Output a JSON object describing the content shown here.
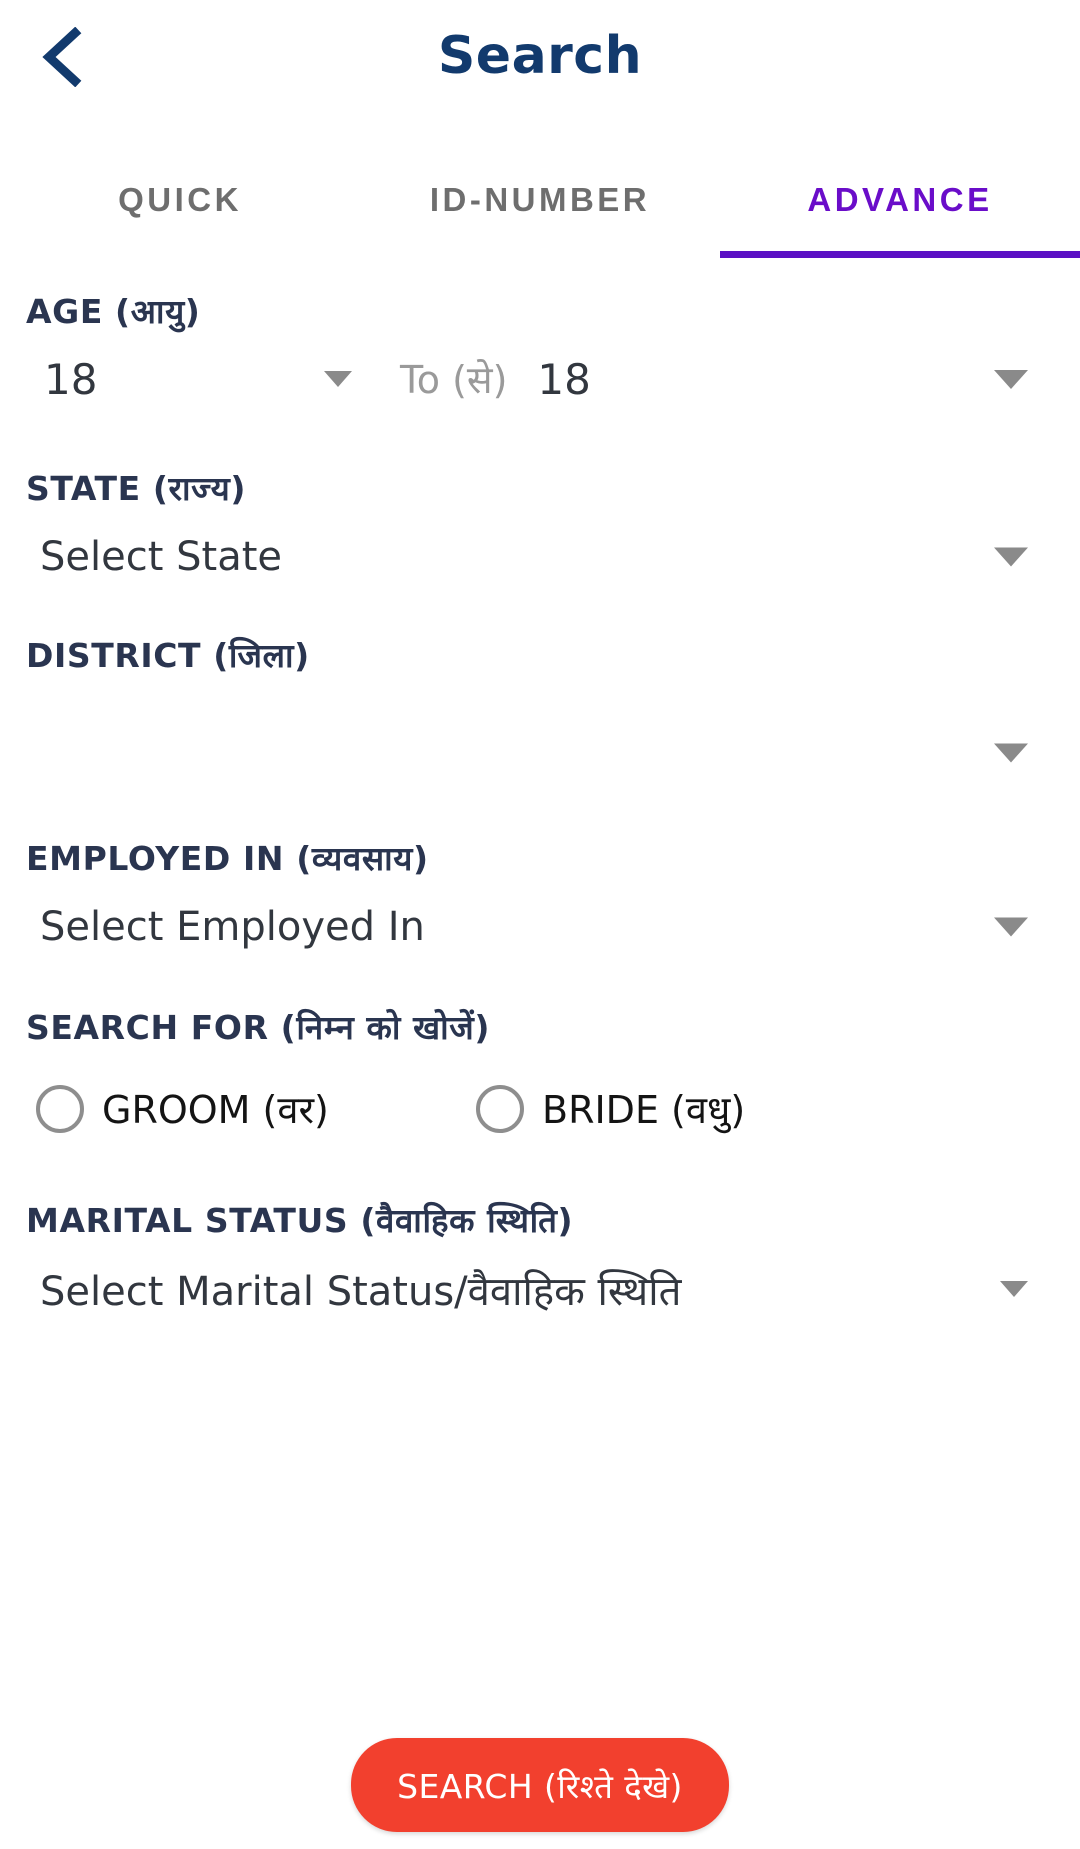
{
  "header": {
    "title": "Search",
    "back_icon": "chevron-left-icon",
    "title_color": "#123A6D"
  },
  "tabs": {
    "items": [
      {
        "label": "QUICK",
        "active": false
      },
      {
        "label": "ID-NUMBER",
        "active": false
      },
      {
        "label": "ADVANCE",
        "active": true
      }
    ],
    "active_color": "#6A0DC9",
    "inactive_color": "#6E6E6E",
    "indicator_color": "#5B10C4"
  },
  "form": {
    "age": {
      "label": "AGE (आयु)",
      "from_value": "18",
      "separator_label": "To (से)",
      "to_value": "18",
      "caret_icon": "chevron-down-icon"
    },
    "state": {
      "label": "STATE (राज्य)",
      "value": "Select State",
      "caret_icon": "chevron-down-icon"
    },
    "district": {
      "label": "DISTRICT (जिला)",
      "value": "",
      "caret_icon": "chevron-down-icon"
    },
    "employed_in": {
      "label": "EMPLOYED IN (व्यवसाय)",
      "value": "Select Employed In",
      "caret_icon": "chevron-down-icon"
    },
    "search_for": {
      "label": "SEARCH FOR (निम्न को खोजें)",
      "options": [
        {
          "label": "GROOM (वर)",
          "selected": false
        },
        {
          "label": "BRIDE (वधु)",
          "selected": false
        }
      ]
    },
    "marital_status": {
      "label": "MARITAL STATUS (वैवाहिक स्थिति)",
      "value": "Select Marital  Status/वैवाहिक स्थिति",
      "caret_icon": "chevron-down-icon"
    }
  },
  "actions": {
    "search_button": "SEARCH (रिश्ते देखे)",
    "search_button_color": "#F2402E"
  }
}
